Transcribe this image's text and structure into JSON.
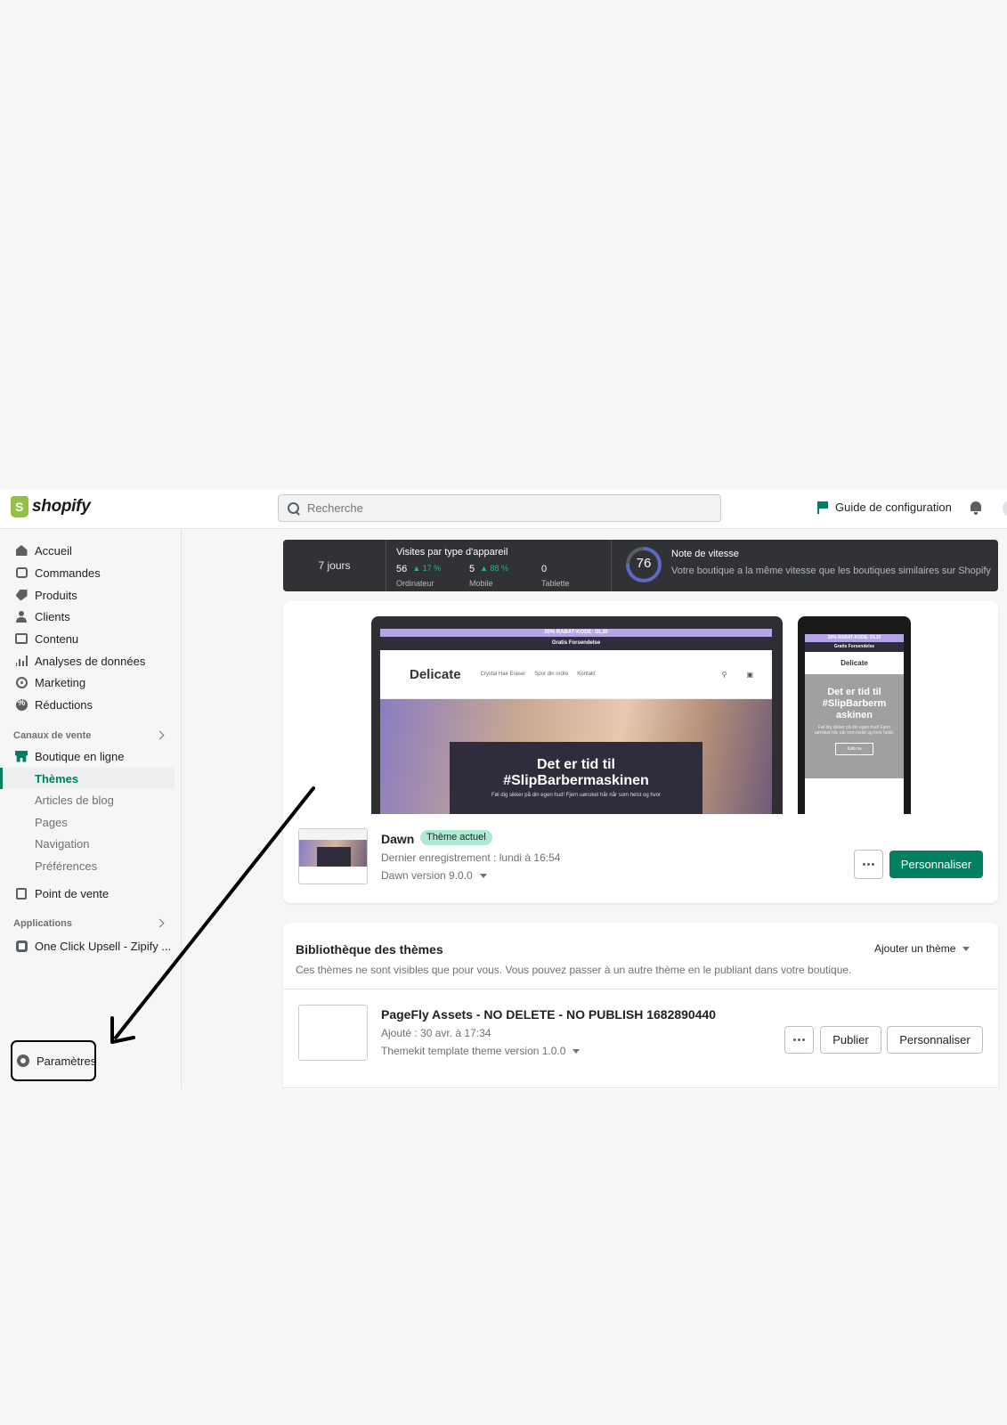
{
  "topbar": {
    "brand": "shopify",
    "search_placeholder": "Recherche",
    "setup_guide": "Guide de configuration"
  },
  "sidebar": {
    "main_items": [
      {
        "label": "Accueil",
        "icon": "home-icon"
      },
      {
        "label": "Commandes",
        "icon": "orders-icon"
      },
      {
        "label": "Produits",
        "icon": "tag-icon"
      },
      {
        "label": "Clients",
        "icon": "person-icon"
      },
      {
        "label": "Contenu",
        "icon": "image-icon"
      },
      {
        "label": "Analyses de données",
        "icon": "bar-chart-icon"
      },
      {
        "label": "Marketing",
        "icon": "target-icon"
      },
      {
        "label": "Réductions",
        "icon": "discount-icon"
      }
    ],
    "sales_channels_label": "Canaux de vente",
    "online_store": "Boutique en ligne",
    "online_store_sub": [
      "Thèmes",
      "Articles de blog",
      "Pages",
      "Navigation",
      "Préférences"
    ],
    "point_of_sale": "Point de vente",
    "apps_label": "Applications",
    "app_item": "One Click Upsell - Zipify ...",
    "settings": "Paramètres"
  },
  "analytics": {
    "period": "7 jours",
    "visits_title": "Visites par type d'appareil",
    "desktop": {
      "value": "56",
      "delta": "17 %",
      "label": "Ordinateur"
    },
    "mobile": {
      "value": "5",
      "delta": "88 %",
      "label": "Mobile"
    },
    "tablet": {
      "value": "0",
      "label": "Tablette"
    },
    "speed_score": "76",
    "speed_score_fraction": 0.76,
    "speed_title": "Note de vitesse",
    "speed_desc": "Votre boutique a la même vitesse que les boutiques similaires sur Shopify"
  },
  "preview": {
    "promo_bar": "30% RABAT-KODE: DL30",
    "shipping_bar": "Gratis Forsendelse",
    "store_logo": "Delicate",
    "nav_links": [
      "Crystal Hair Eraser",
      "Spor din ordre",
      "Kontakt"
    ],
    "hero_line1": "Det er tid til",
    "hero_line2": "#SlipBarbermaskinen",
    "hero_small": "Føl dig sikker på din egen hud! Fjern uønsket hår når som helst og hvor",
    "phone_promo_bar": "30% RABAT-KODE: DL30",
    "phone_shipping_bar": "Gratis Forsendelse",
    "phone_logo": "Delicate",
    "phone_hero_title": "Det er tid til #SlipBarberm askinen",
    "phone_hero_small": "Føl dig sikker på din egen hud! Fjern uønsket hår når som helst og hvor helst.",
    "phone_button": "Køb nu"
  },
  "current_theme": {
    "name": "Dawn",
    "badge": "Thème actuel",
    "saved": "Dernier enregistrement : lundi à 16:54",
    "version": "Dawn version 9.0.0",
    "customize": "Personnaliser"
  },
  "library": {
    "title": "Bibliothèque des thèmes",
    "add_theme": "Ajouter un thème",
    "description": "Ces thèmes ne sont visibles que pour vous. Vous pouvez passer à un autre thème en le publiant dans votre boutique.",
    "theme_name": "PageFly Assets - NO DELETE - NO PUBLISH 1682890440",
    "theme_added": "Ajouté : 30 avr. à 17:34",
    "theme_version": "Themekit template theme version 1.0.0",
    "publish": "Publier",
    "customize": "Personnaliser"
  },
  "colors": {
    "accent": "#008060",
    "badge_bg": "#aee9d1",
    "analytics_bg": "#303235",
    "speed_ring": "#5c6ac4"
  }
}
